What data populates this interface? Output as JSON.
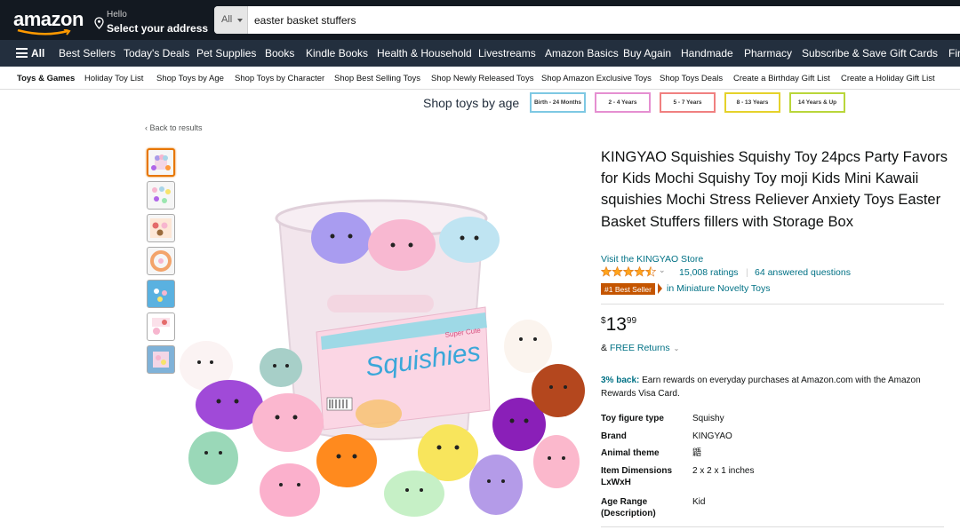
{
  "header": {
    "logo": "amazon",
    "deliver_hello": "Hello",
    "deliver_address": "Select your address",
    "search_category": "All",
    "search_value": "easter basket stuffers"
  },
  "nav": {
    "all": "All",
    "items": [
      "Best Sellers",
      "Today's Deals",
      "Pet Supplies",
      "Books",
      "Kindle Books",
      "Health & Household",
      "Livestreams",
      "Amazon Basics",
      "Buy Again",
      "Handmade",
      "Pharmacy",
      "Subscribe & Save",
      "Gift Cards",
      "Fin"
    ]
  },
  "subnav": {
    "items": [
      "Toys & Games",
      "Holiday Toy List",
      "Shop Toys by Age",
      "Shop Toys by Character",
      "Shop Best Selling Toys",
      "Shop Newly Released Toys",
      "Shop Amazon Exclusive Toys",
      "Shop Toys Deals",
      "Create a Birthday Gift List",
      "Create a Holiday Gift List"
    ]
  },
  "age_bar": {
    "label": "Shop toys by age",
    "buttons": [
      {
        "label": "Birth - 24 Months",
        "color": "#7ec8e3"
      },
      {
        "label": "2 - 4 Years",
        "color": "#e58fd1"
      },
      {
        "label": "5 - 7 Years",
        "color": "#f08080"
      },
      {
        "label": "8 - 13 Years",
        "color": "#e5d22b"
      },
      {
        "label": "14 Years & Up",
        "color": "#b9d63a"
      }
    ]
  },
  "back_link": "Back to results",
  "product": {
    "title": "KINGYAO Squishies Squishy Toy 24pcs Party Favors for Kids Mochi Squishy Toy moji Kids Mini Kawaii squishies Mochi Stress Reliever Anxiety Toys Easter Basket Stuffers fillers with Storage Box",
    "store": "Visit the KINGYAO Store",
    "rating": 4.5,
    "ratings_count": "15,008 ratings",
    "separator": "|",
    "answered": "64 answered questions",
    "badge": "#1 Best Seller",
    "badge_category": "in Miniature Novelty Toys",
    "price_symbol": "$",
    "price_whole": "13",
    "price_fraction": "99",
    "returns_amp": "&",
    "returns": "FREE Returns",
    "cashback_bold": "3% back:",
    "cashback_text": "Earn rewards on everyday purchases at Amazon.com with the Amazon Rewards Visa Card.",
    "image_label": "Squishies",
    "image_sublabel": "Super Cute",
    "specs": [
      {
        "key": "Toy figure type",
        "value": "Squishy"
      },
      {
        "key": "Brand",
        "value": "KINGYAO"
      },
      {
        "key": "Animal theme",
        "value": "鼯"
      },
      {
        "key": "Item Dimensions LxWxH",
        "value": "2 x 2 x 1 inches"
      },
      {
        "key": "Age Range (Description)",
        "value": "Kid"
      }
    ]
  },
  "colors": {
    "header_bg": "#131921",
    "nav_bg": "#232f3e",
    "link": "#007185",
    "badge": "#c45500",
    "thumb_selected": "#e77600",
    "star": "#ffa41c"
  }
}
